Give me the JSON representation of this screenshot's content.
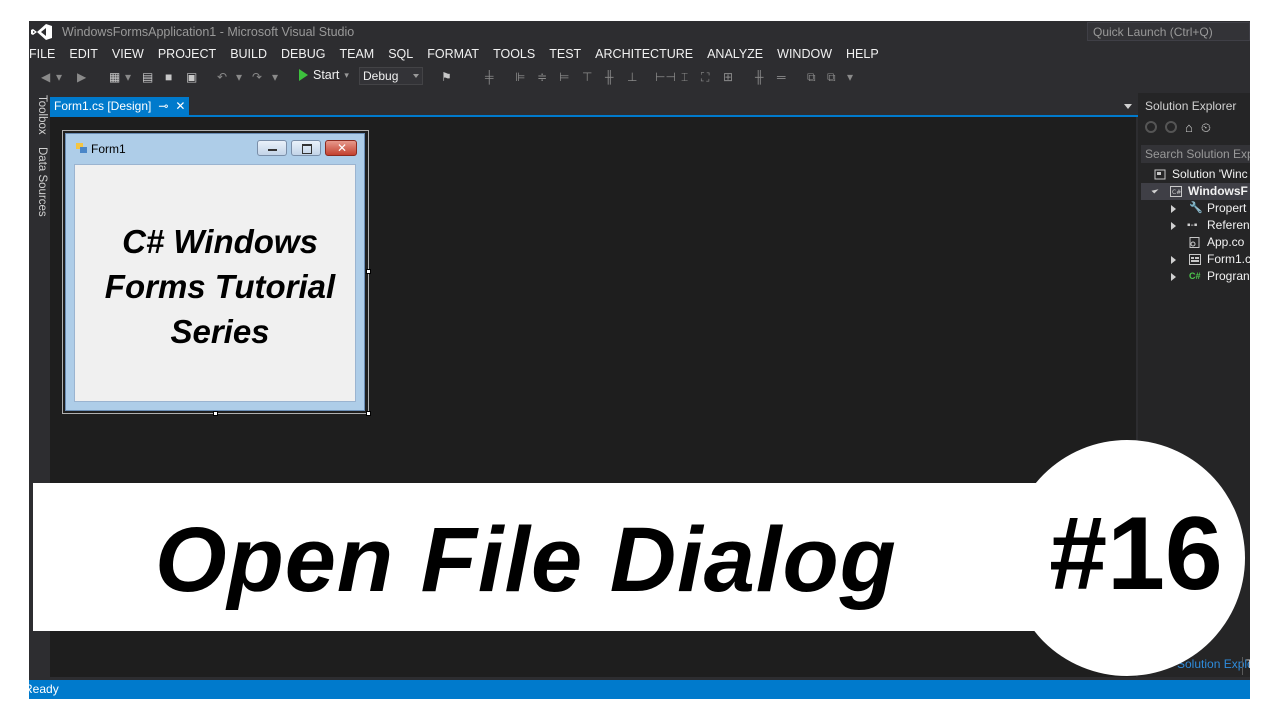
{
  "window": {
    "title": "WindowsFormsApplication1 - Microsoft Visual Studio",
    "quick_launch_placeholder": "Quick Launch (Ctrl+Q)"
  },
  "menu": [
    "FILE",
    "EDIT",
    "VIEW",
    "PROJECT",
    "BUILD",
    "DEBUG",
    "TEAM",
    "SQL",
    "FORMAT",
    "TOOLS",
    "TEST",
    "ARCHITECTURE",
    "ANALYZE",
    "WINDOW",
    "HELP"
  ],
  "toolbar": {
    "start_label": "Start",
    "configuration": "Debug"
  },
  "left_dock": {
    "toolbox_label": "Toolbox",
    "data_sources_label": "Data Sources"
  },
  "document_tab": {
    "label": "Form1.cs [Design]",
    "pin_glyph": "⊸",
    "close_glyph": "✕"
  },
  "designer": {
    "form_title": "Form1",
    "form_caption": "C# Windows Forms Tutorial Series"
  },
  "solution_explorer": {
    "title": "Solution Explorer",
    "search_placeholder": "Search Solution Exp",
    "items": [
      {
        "label": "Solution 'Winc",
        "icon": "solution-icon"
      },
      {
        "label": "WindowsF",
        "icon": "csharp-project-icon"
      },
      {
        "label": "Propert",
        "icon": "wrench-icon"
      },
      {
        "label": "Referen",
        "icon": "references-icon"
      },
      {
        "label": "App.co",
        "icon": "config-file-icon"
      },
      {
        "label": "Form1.c",
        "icon": "form-file-icon"
      },
      {
        "label": "Progran",
        "icon": "csharp-file-icon"
      }
    ],
    "bottom_tab": "Solution Explorer",
    "bottom_tab2": "T"
  },
  "status": {
    "text": "Ready"
  },
  "overlay": {
    "title": "Open File Dialog",
    "number": "#16"
  },
  "colors": {
    "accent": "#007acc",
    "background": "#2d2d30",
    "designer_surface": "#1e1e1e"
  }
}
